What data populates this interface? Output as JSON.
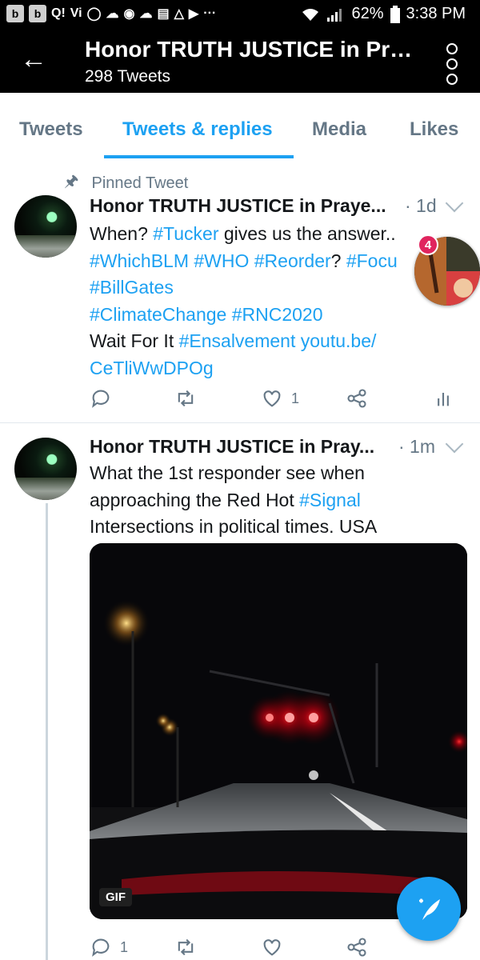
{
  "status_bar": {
    "left_icons": [
      "b",
      "b",
      "Q!",
      "Vi"
    ],
    "battery": "62%",
    "time": "3:38 PM",
    "dots": "···"
  },
  "header": {
    "title": "Honor TRUTH JUSTICE in Pra...",
    "subtitle": "298 Tweets"
  },
  "tabs": [
    "Tweets",
    "Tweets & replies",
    "Media",
    "Likes"
  ],
  "tweets": [
    {
      "pinned_label": "Pinned Tweet",
      "name": "Honor TRUTH JUSTICE in Praye...",
      "time": "· 1d",
      "lines": [
        {
          "a": "When? ",
          "b": "#Tucker",
          "c": " gives us the answer.."
        },
        {
          "a": "",
          "b": "#WhichBLM #WHO #Reorder",
          "c": "? ",
          "d": "#Focu"
        },
        {
          "a": "",
          "b": "#BillGates",
          "c": ""
        },
        {
          "a": "",
          "b": "#ClimateChange #RNC2020",
          "c": ""
        },
        {
          "a": "Wait For It ",
          "b": "#Ensalvement  youtu.be/",
          "c": ""
        },
        {
          "a": "",
          "b": "CeTliWwDPOg",
          "c": ""
        }
      ],
      "reply_count": "",
      "retweet_count": "",
      "like_count": "1"
    },
    {
      "name": "Honor TRUTH JUSTICE in Pray...",
      "time": "· 1m",
      "lines": [
        {
          "a": "What the 1st responder see when",
          "b": "",
          "c": ""
        },
        {
          "a": "approaching the Red Hot ",
          "b": "#Signal",
          "c": ""
        },
        {
          "a": "Intersections in political times. USA",
          "b": "",
          "c": ""
        }
      ],
      "media_badge": "GIF",
      "reply_count": "1",
      "retweet_count": "",
      "like_count": ""
    }
  ],
  "chat_head": {
    "badge": "4"
  },
  "colors": {
    "accent": "#1da1f2",
    "muted": "#657786",
    "header_bg": "#000000"
  }
}
